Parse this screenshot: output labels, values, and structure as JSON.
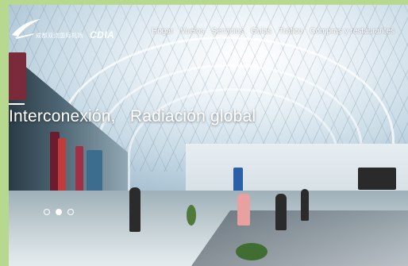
{
  "brand": {
    "logo_text_cn": "成都双流国际机场",
    "logo_abbr": "CDIA"
  },
  "nav": {
    "items": [
      {
        "label": "Hogar"
      },
      {
        "label": "Vuelos"
      },
      {
        "label": "Servicios"
      },
      {
        "label": "Guias"
      },
      {
        "label": "Tráfico"
      },
      {
        "label": "Compras y restaurantes"
      }
    ]
  },
  "hero": {
    "headline_part1": "Interconexión,",
    "headline_part2": "Radiación global"
  },
  "carousel": {
    "slides": 3,
    "active_index": 1
  },
  "colors": {
    "page_background": "#b6d88f",
    "text_light": "#ffffff"
  }
}
